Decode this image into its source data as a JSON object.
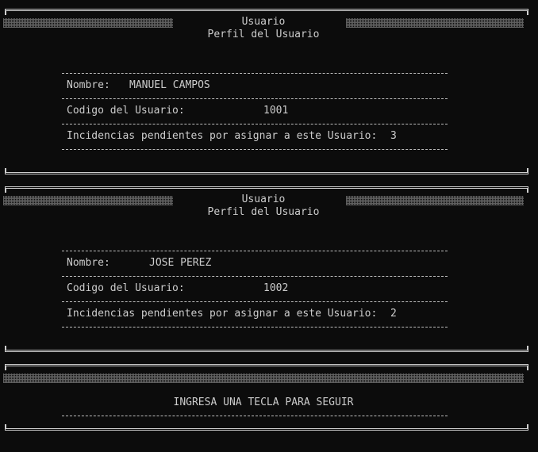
{
  "profiles": [
    {
      "heading": "Usuario",
      "subheading": "Perfil del Usuario",
      "name_label": "Nombre:",
      "name_value": "MANUEL CAMPOS",
      "code_label": "Codigo del Usuario:",
      "code_value": "1001",
      "pending_label": "Incidencias pendientes por asignar a este Usuario:",
      "pending_value": "3"
    },
    {
      "heading": "Usuario",
      "subheading": "Perfil del Usuario",
      "name_label": "Nombre:",
      "name_value": "JOSE PEREZ",
      "code_label": "Codigo del Usuario:",
      "code_value": "1002",
      "pending_label": "Incidencias pendientes por asignar a este Usuario:",
      "pending_value": "2"
    }
  ],
  "prompt": {
    "text": "INGRESA UNA TECLA PARA SEGUIR"
  }
}
